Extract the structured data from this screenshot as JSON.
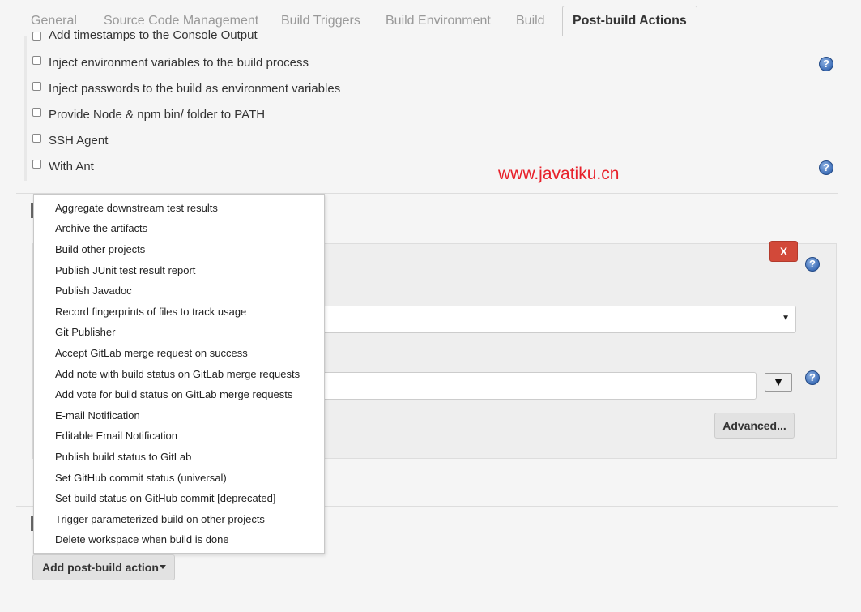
{
  "tabs": [
    {
      "label": "General"
    },
    {
      "label": "Source Code Management"
    },
    {
      "label": "Build Triggers"
    },
    {
      "label": "Build Environment"
    },
    {
      "label": "Build"
    },
    {
      "label": "Post-build Actions"
    }
  ],
  "build_wrappers": [
    {
      "label": "Add timestamps to the Console Output",
      "checked": false
    },
    {
      "label": "Inject environment variables to the build process",
      "checked": false
    },
    {
      "label": "Inject passwords to the build as environment variables",
      "checked": false
    },
    {
      "label": "Provide Node & npm bin/ folder to PATH",
      "checked": false
    },
    {
      "label": "SSH Agent",
      "checked": false
    },
    {
      "label": "With Ant",
      "checked": false
    }
  ],
  "help_glyph": "?",
  "watermark": "www.javatiku.cn",
  "panel": {
    "delete_label": "X",
    "dropdown_arrow": "▼",
    "advanced_label": "Advanced..."
  },
  "menu": {
    "items": [
      "Aggregate downstream test results",
      "Archive the artifacts",
      "Build other projects",
      "Publish JUnit test result report",
      "Publish Javadoc",
      "Record fingerprints of files to track usage",
      "Git Publisher",
      "Accept GitLab merge request on success",
      "Add note with build status on GitLab merge requests",
      "Add vote for build status on GitLab merge requests",
      "E-mail Notification",
      "Editable Email Notification",
      "Publish build status to GitLab",
      "Set GitHub commit status (universal)",
      "Set build status on GitHub commit [deprecated]",
      "Trigger parameterized build on other projects",
      "Delete workspace when build is done"
    ]
  },
  "add_post_build_label": "Add post-build action",
  "colors": {
    "delete_red": "#d24939",
    "watermark_red": "#e8202a",
    "help_blue": "#3f6fb8"
  }
}
